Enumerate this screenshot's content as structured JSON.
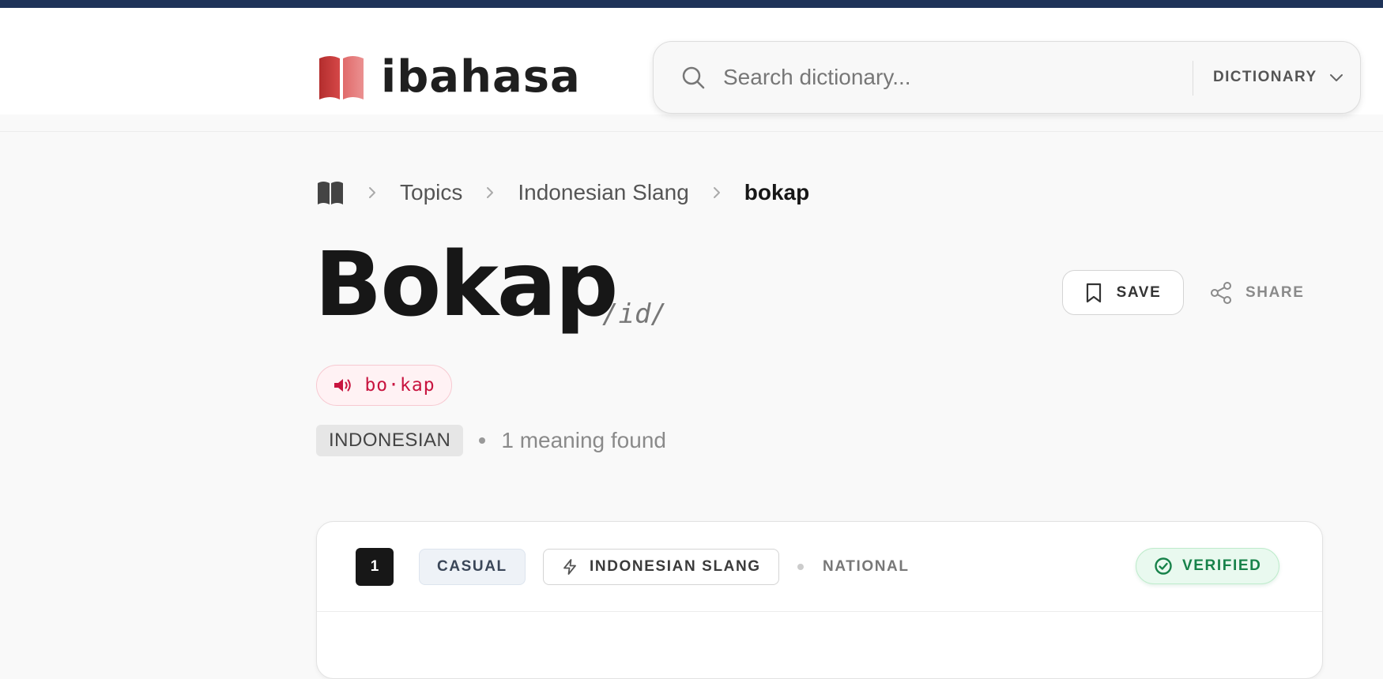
{
  "brand": {
    "name": "ibahasa",
    "accent_color": "#c93a3a",
    "top_strip_color": "#1e3358"
  },
  "search": {
    "placeholder": "Search dictionary...",
    "value": "",
    "scope": "DICTIONARY",
    "icon": "search-icon",
    "scope_icon": "chevron-down-icon"
  },
  "breadcrumb": {
    "home_icon": "book-icon",
    "items": [
      "Topics",
      "Indonesian Slang"
    ],
    "current": "bokap"
  },
  "entry": {
    "word": "Bokap",
    "lang_code": "/id/",
    "pronunciation": "bo·kap",
    "pronunciation_icon": "speaker-icon",
    "pronunciation_color": "#c8143f",
    "language": "INDONESIAN",
    "meaning_count": "1 meaning found"
  },
  "actions": {
    "save_label": "SAVE",
    "save_icon": "bookmark-icon",
    "share_label": "SHARE",
    "share_icon": "share-icon"
  },
  "sense": {
    "number": "1",
    "register": "CASUAL",
    "topic": "INDONESIAN SLANG",
    "topic_icon": "lightning-icon",
    "region": "NATIONAL",
    "status": "VERIFIED",
    "status_icon": "check-circle-icon",
    "status_color": "#17824a"
  }
}
